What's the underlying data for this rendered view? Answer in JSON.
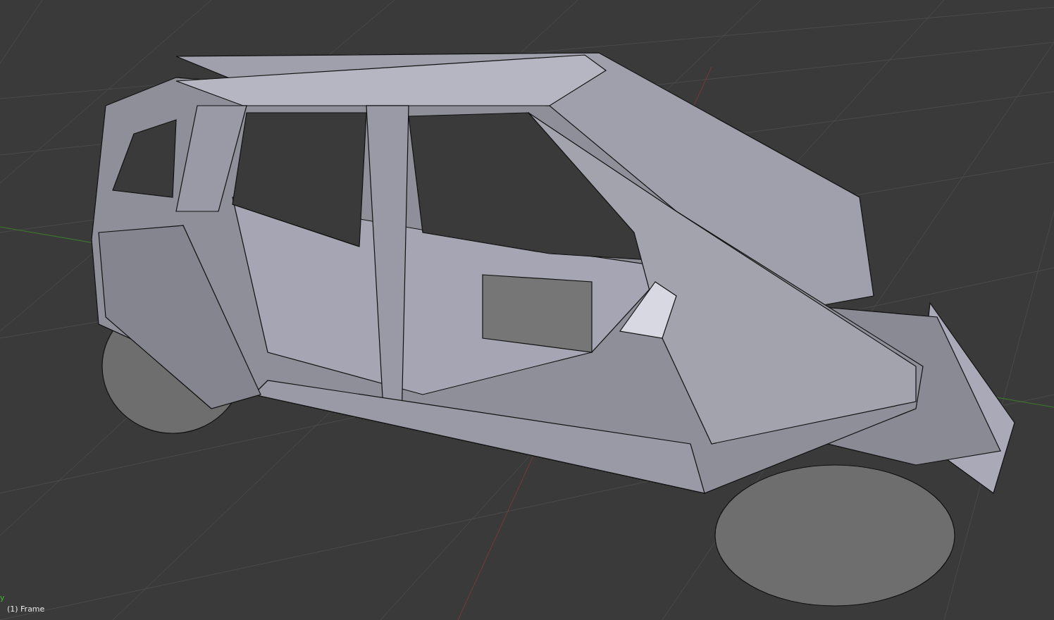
{
  "viewport": {
    "axis_label": "y",
    "frame_info": "(1) Frame"
  }
}
